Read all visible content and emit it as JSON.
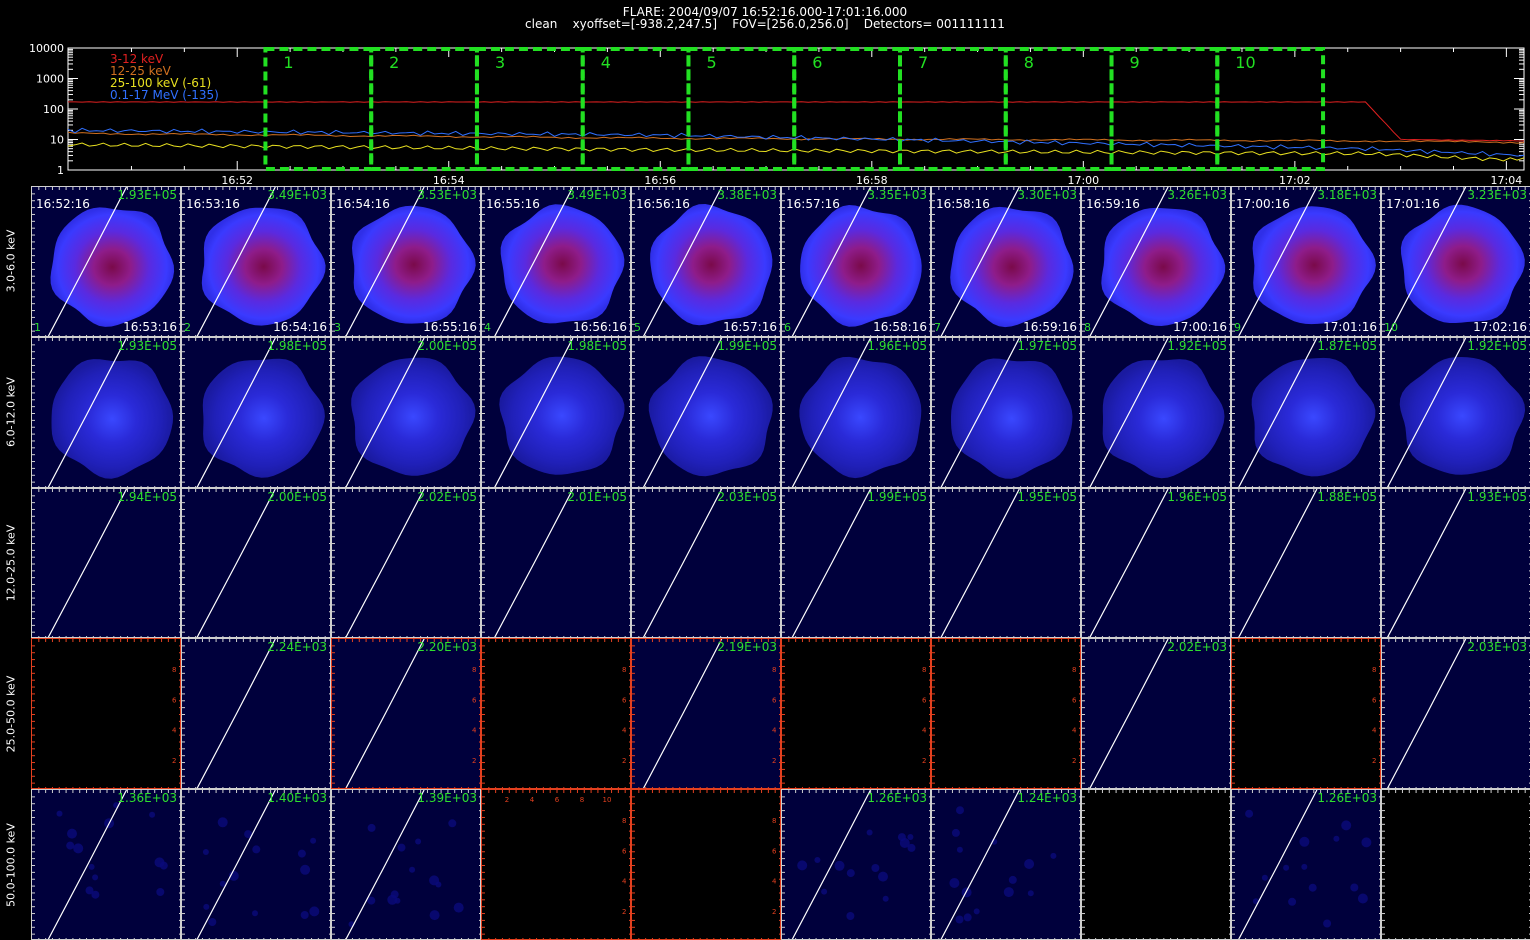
{
  "header": {
    "line1": "FLARE: 2004/09/07 16:52:16.000-17:01:16.000",
    "line2": "clean    xyoffset=[-938.2,247.5]    FOV=[256.0,256.0]    Detectors= 001111111"
  },
  "chart_data": [
    {
      "type": "line",
      "yscale": "log",
      "ylim": [
        1,
        10000
      ],
      "ytick_labels": [
        "10000",
        "1000",
        "100",
        "10",
        "1"
      ],
      "xtick_labels": [
        "16:52",
        "16:54",
        "16:56",
        "16:58",
        "17:00",
        "17:02",
        "17:04"
      ],
      "xlim": [
        "16:50:24",
        "17:04:10"
      ],
      "series": [
        {
          "name": "3-12 keV",
          "color": "#e02020",
          "x": [
            "16:50:24",
            "17:02:40",
            "17:03:00",
            "17:04:10"
          ],
          "values": [
            170,
            170,
            10,
            9
          ]
        },
        {
          "name": "12-25 keV",
          "color": "#d07020",
          "x": [
            "16:50:24",
            "16:56:00",
            "17:02:40",
            "17:04:10"
          ],
          "values": [
            16,
            11,
            9,
            8
          ]
        },
        {
          "name": "25-100 keV (-61)",
          "color": "#e8e020",
          "x": [
            "16:50:24",
            "16:56:00",
            "17:02:40",
            "17:04:10"
          ],
          "values": [
            6,
            4,
            3,
            2.5
          ]
        },
        {
          "name": "0.1-17 MeV (-135)",
          "color": "#3070ff",
          "x": [
            "16:50:24",
            "16:56:00",
            "17:02:40",
            "17:04:10"
          ],
          "values": [
            20,
            14,
            5,
            3
          ]
        }
      ],
      "intervals": {
        "color": "#22e022",
        "labels": [
          "1",
          "2",
          "3",
          "4",
          "5",
          "6",
          "7",
          "8",
          "9",
          "10"
        ],
        "x_start": [
          "16:52:16",
          "16:53:16",
          "16:54:16",
          "16:55:16",
          "16:56:16",
          "16:57:16",
          "16:58:16",
          "16:59:16",
          "17:00:16",
          "17:01:16"
        ],
        "x_end": [
          "16:53:16",
          "16:54:16",
          "16:55:16",
          "16:56:16",
          "16:57:16",
          "16:58:16",
          "16:59:16",
          "17:00:16",
          "17:01:16",
          "17:02:16"
        ]
      }
    },
    {
      "type": "heatmap",
      "row_labels": [
        "3.0-6.0 keV",
        "6.0-12.0 keV",
        "12.0-25.0 keV",
        "25.0-50.0 keV",
        "50.0-100.0 keV"
      ],
      "start_times": [
        "16:52:16",
        "16:53:16",
        "16:54:16",
        "16:55:16",
        "16:56:16",
        "16:57:16",
        "16:58:16",
        "16:59:16",
        "17:00:16",
        "17:01:16"
      ],
      "end_times": [
        "16:53:16",
        "16:54:16",
        "16:55:16",
        "16:56:16",
        "16:57:16",
        "16:58:16",
        "16:59:16",
        "17:00:16",
        "17:01:16",
        "17:02:16"
      ],
      "panel_numbers": [
        "1",
        "2",
        "3",
        "4",
        "5",
        "6",
        "7",
        "8",
        "9",
        "10"
      ],
      "peaks": [
        [
          "1.93E+05",
          "3.49E+03",
          "3.53E+03",
          "3.49E+03",
          "3.38E+03",
          "3.35E+03",
          "3.30E+03",
          "3.26E+03",
          "3.18E+03",
          "3.23E+03"
        ],
        [
          "1.93E+05",
          "1.98E+05",
          "2.00E+05",
          "1.98E+05",
          "1.99E+05",
          "1.96E+05",
          "1.97E+05",
          "1.92E+05",
          "1.87E+05",
          "1.92E+05"
        ],
        [
          "1.94E+05",
          "2.00E+05",
          "2.02E+05",
          "2.01E+05",
          "2.03E+05",
          "1.99E+05",
          "1.95E+05",
          "1.96E+05",
          "1.88E+05",
          "1.93E+05"
        ],
        [
          "",
          "2.24E+03",
          "2.20E+03",
          "",
          "2.19E+03",
          "",
          "",
          "2.02E+03",
          "",
          "2.03E+03"
        ],
        [
          "1.36E+03",
          "1.40E+03",
          "1.39E+03",
          "",
          "",
          "1.26E+03",
          "1.24E+03",
          "",
          "1.26E+03",
          ""
        ]
      ],
      "panel_kind": [
        [
          "strong",
          "strong",
          "strong",
          "strong",
          "strong",
          "strong",
          "strong",
          "strong",
          "strong",
          "strong"
        ],
        [
          "medium",
          "medium",
          "medium",
          "medium",
          "medium",
          "medium",
          "medium",
          "medium",
          "medium",
          "medium"
        ],
        [
          "faint",
          "faint",
          "faint",
          "faint",
          "faint",
          "faint",
          "faint",
          "faint",
          "faint",
          "faint"
        ],
        [
          "empty",
          "faint",
          "faint",
          "empty",
          "faint",
          "empty",
          "empty",
          "faint",
          "empty",
          "faint"
        ],
        [
          "noise",
          "noise",
          "noise",
          "empty",
          "empty",
          "noise",
          "noise",
          "empty",
          "noise",
          "empty"
        ]
      ],
      "red_axis_panels": [
        [
          3,
          0
        ],
        [
          3,
          2
        ],
        [
          3,
          3
        ],
        [
          3,
          4
        ],
        [
          3,
          5
        ],
        [
          3,
          6
        ],
        [
          3,
          8
        ],
        [
          4,
          3
        ],
        [
          4,
          4
        ]
      ],
      "red_tick_labels_y": [
        "2",
        "4",
        "6",
        "8"
      ],
      "red_tick_labels_x": [
        "2",
        "4",
        "6",
        "8",
        "10"
      ],
      "colors": {
        "limb": "#ffffff",
        "panel_bg": "#00003c",
        "empty_bg": "#000000",
        "axis": "#cfcfcf",
        "red_axis": "#e3401f",
        "annotation": "#2ee02e"
      }
    }
  ]
}
